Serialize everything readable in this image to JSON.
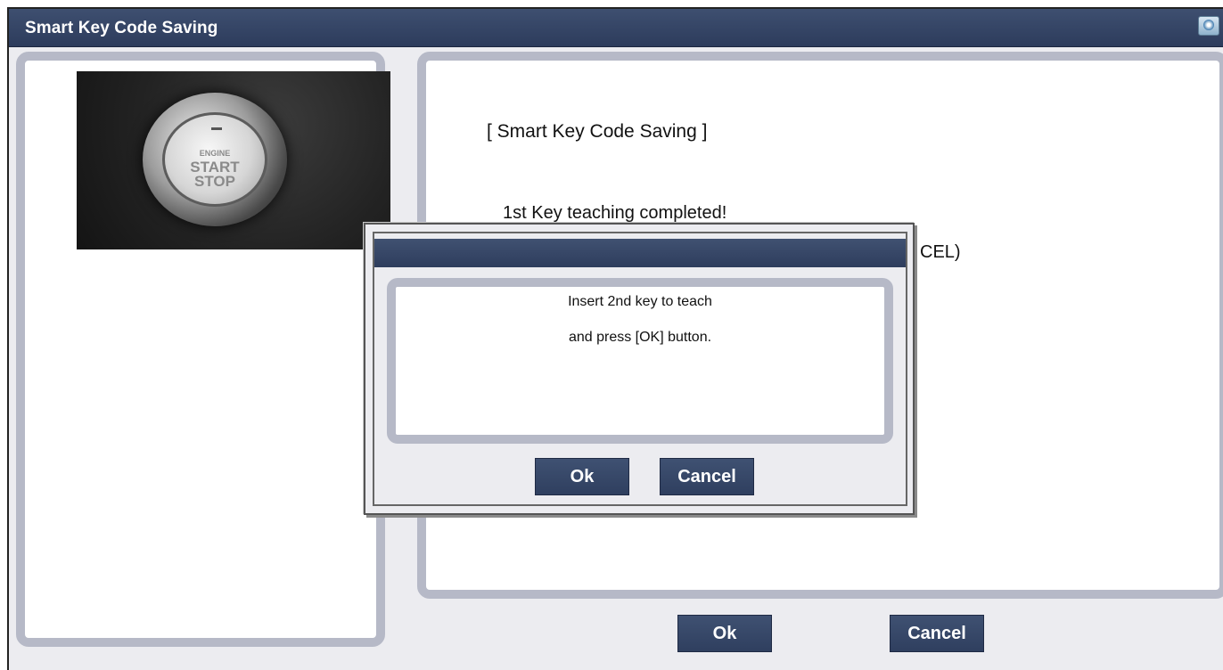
{
  "window": {
    "title": "Smart Key Code Saving",
    "title_icon": "help-icon",
    "accent_color": "#34456a"
  },
  "photo": {
    "text_small": "ENGINE",
    "text_line1": "START",
    "text_line2": "STOP"
  },
  "content": {
    "heading": "[ Smart Key Code Saving ]",
    "message": "1st Key teaching completed!",
    "partial_line": "CEL)"
  },
  "buttons": {
    "ok": "Ok",
    "cancel": "Cancel"
  },
  "dialog": {
    "title": "",
    "line1": "Insert 2nd key to teach",
    "line2": "and press [OK] button.",
    "ok": "Ok",
    "cancel": "Cancel"
  }
}
